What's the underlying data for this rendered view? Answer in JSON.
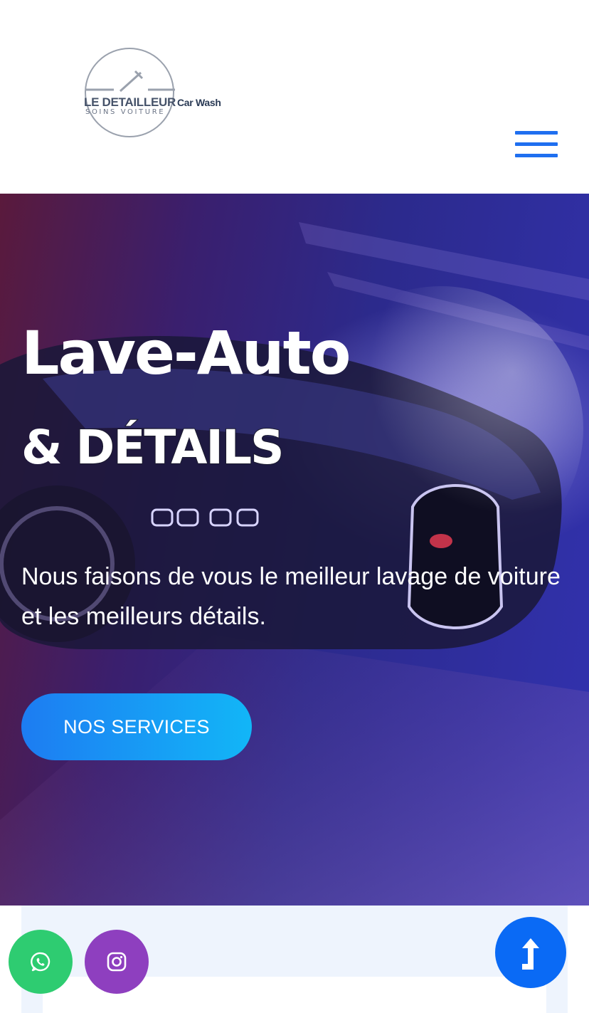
{
  "brand": {
    "name": "LE DETAILLEUR",
    "suffix": "Car Wash",
    "tagline": "SOINS VOITURE"
  },
  "header": {
    "menu_icon": "hamburger-menu-icon"
  },
  "hero": {
    "title": "Lave-Auto",
    "subtitle_prefix": "&",
    "subtitle_outline": "DÉTAILS",
    "description": "Nous faisons de vous le meilleur lavage de voiture et les meilleurs détails.",
    "cta_label": "NOS SERVICES"
  },
  "floating": {
    "whatsapp_icon": "whatsapp-icon",
    "instagram_icon": "instagram-icon",
    "scroll_top_icon": "arrow-up-icon"
  },
  "colors": {
    "accent": "#1f6ff0",
    "cta_gradient_start": "#1d7cf2",
    "cta_gradient_end": "#12b6f7",
    "whatsapp": "#2ecc71",
    "instagram": "#8e3fbf",
    "scroll_top": "#0a6af5"
  }
}
